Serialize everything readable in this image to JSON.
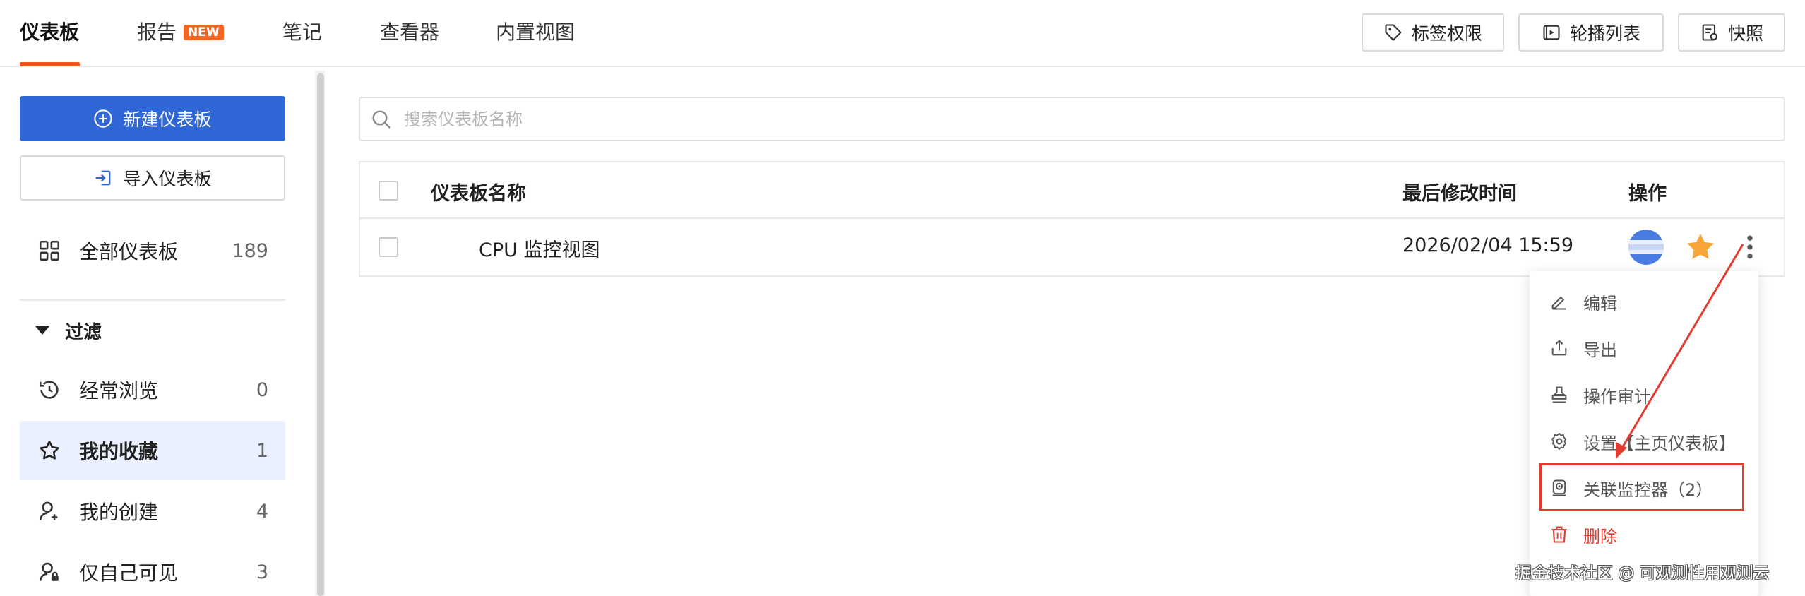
{
  "nav": {
    "tabs": [
      {
        "label": "仪表板"
      },
      {
        "label": "报告",
        "badge": "NEW"
      },
      {
        "label": "笔记"
      },
      {
        "label": "查看器"
      },
      {
        "label": "内置视图"
      }
    ],
    "buttons": {
      "tag_permissions": "标签权限",
      "carousel": "轮播列表",
      "snapshot": "快照"
    }
  },
  "sidebar": {
    "new_dashboard": "新建仪表板",
    "import_dashboard": "导入仪表板",
    "all": {
      "label": "全部仪表板",
      "count": "189"
    },
    "filter_label": "过滤",
    "items": [
      {
        "label": "经常浏览",
        "count": "0"
      },
      {
        "label": "我的收藏",
        "count": "1"
      },
      {
        "label": "我的创建",
        "count": "4"
      },
      {
        "label": "仅自己可见",
        "count": "3"
      }
    ]
  },
  "search": {
    "placeholder": "搜索仪表板名称",
    "value": ""
  },
  "table": {
    "headers": {
      "name": "仪表板名称",
      "modified": "最后修改时间",
      "actions": "操作"
    },
    "rows": [
      {
        "name": "CPU 监控视图",
        "modified": "2026/02/04 15:59",
        "favorited": true
      }
    ]
  },
  "menu": {
    "items": [
      {
        "label": "编辑",
        "icon": "edit-icon"
      },
      {
        "label": "导出",
        "icon": "export-icon"
      },
      {
        "label": "操作审计",
        "icon": "audit-stamp-icon"
      },
      {
        "label": "设置【主页仪表板】",
        "icon": "gear-icon"
      },
      {
        "label": "关联监控器（2）",
        "icon": "monitor-icon"
      },
      {
        "label": "删除",
        "icon": "trash-icon"
      }
    ]
  },
  "watermark": "掘金技术社区 @ 可观测性用观测云",
  "colors": {
    "accent": "#2f67d6",
    "tab_underline": "#f05a22",
    "badge": "#f26522",
    "selected_bg": "#eaf0fd",
    "star": "#f7a536",
    "danger": "#e03a2f",
    "highlight": "#e33b2f"
  }
}
